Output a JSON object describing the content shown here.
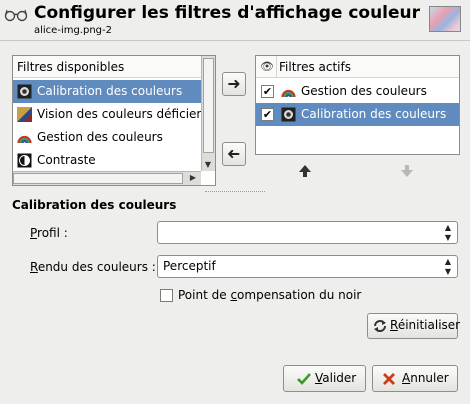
{
  "header": {
    "title": "Configurer les filtres d'affichage couleur",
    "subtitle": "alice-img.png-2"
  },
  "available": {
    "heading": "Filtres disponibles",
    "items": [
      {
        "label": "Calibration des couleurs",
        "icon": "calibration-icon",
        "selected": true
      },
      {
        "label": "Vision des couleurs déficiente",
        "icon": "color-vision-icon",
        "selected": false
      },
      {
        "label": "Gestion des couleurs",
        "icon": "color-management-icon",
        "selected": false
      },
      {
        "label": "Contraste",
        "icon": "contrast-icon",
        "selected": false
      }
    ]
  },
  "active": {
    "heading": "Filtres actifs",
    "header_icon": "eye-icon",
    "items": [
      {
        "label": "Gestion des couleurs",
        "icon": "color-management-icon",
        "checked": true,
        "selected": false
      },
      {
        "label": "Calibration des couleurs",
        "icon": "calibration-icon",
        "checked": true,
        "selected": true
      }
    ]
  },
  "settings": {
    "title": "Calibration des couleurs",
    "profile": {
      "label_prefix": "P",
      "label_rest": "rofil :",
      "value": ""
    },
    "rendering": {
      "label_prefix": "R",
      "label_rest": "endu des couleurs :",
      "value": "Perceptif"
    },
    "bpc": {
      "label_a": "Point de ",
      "label_u": "c",
      "label_b": "ompensation du noir",
      "checked": false
    }
  },
  "buttons": {
    "reset": {
      "prefix": "R",
      "rest": "éinitialiser"
    },
    "ok": {
      "prefix": "V",
      "rest": "alider"
    },
    "cancel": {
      "prefix": "A",
      "rest": "nnuler"
    }
  },
  "colors": {
    "selection": "#5f8bbf",
    "background": "#eeeeec",
    "ok_check": "#3a9a2a",
    "cancel_x": "#d03a1a"
  }
}
